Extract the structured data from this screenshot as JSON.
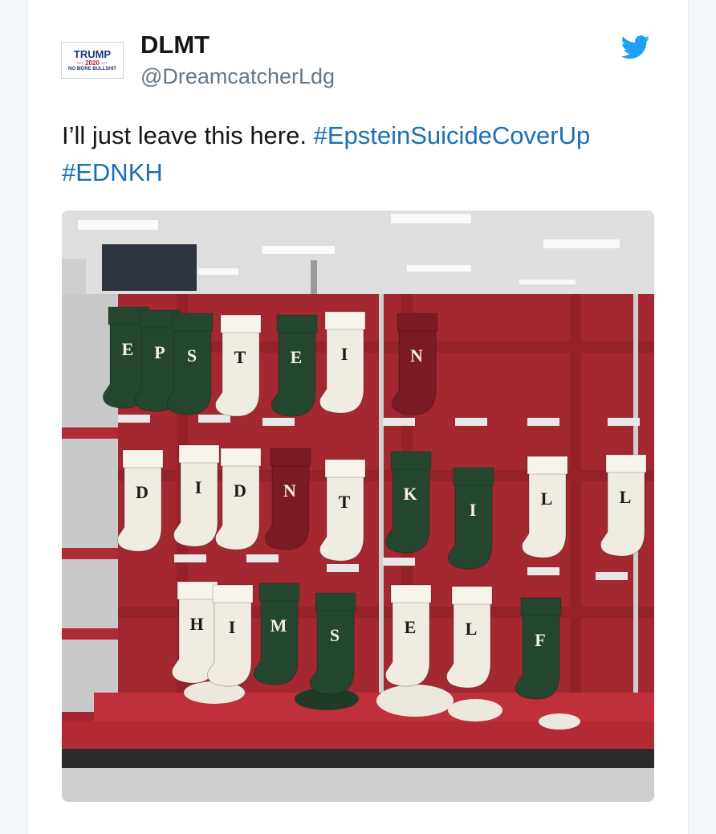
{
  "user": {
    "avatar": {
      "line1": "TRUMP",
      "line2": "··· 2020 ···",
      "line3": "NO MORE BULLSHIT"
    },
    "name": "DLMT",
    "handle": "@DreamcatcherLdg"
  },
  "tweet": {
    "text": "I’ll just leave this here.",
    "hashtags": [
      "#EpsteinSuicideCoverUp",
      "#EDNKH"
    ]
  },
  "photo": {
    "stocking_letters": {
      "row1": [
        "E",
        "P",
        "S",
        "T",
        "E",
        "I",
        "N"
      ],
      "row2": [
        "D",
        "I",
        "D",
        "N",
        "T",
        "K",
        "I",
        "L",
        "L"
      ],
      "row3": [
        "H",
        "I",
        "M",
        "S",
        "E",
        "L",
        "F"
      ]
    },
    "colors": {
      "green": "#24462e",
      "red": "#7a1a24",
      "cream": "#f0ece2",
      "wall": "#a32832"
    }
  },
  "colors": {
    "brand": "#1da1f2",
    "hashtag": "#1b6fb5",
    "text": "#14171a",
    "muted": "#657786"
  },
  "icons": {
    "twitter": "twitter-bird-icon"
  }
}
